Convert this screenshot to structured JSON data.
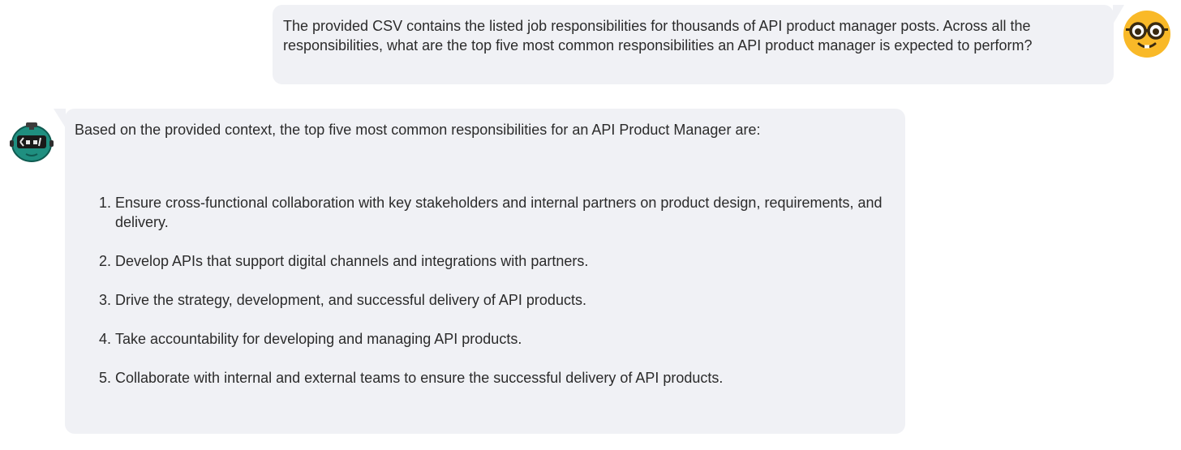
{
  "conversation": {
    "user_message": {
      "text": "The provided CSV contains the listed job responsibilities for thousands of API product manager posts. Across all the responsibilities, what are the top five most common responsibilities an API product manager is expected to perform?",
      "avatar_icon": "nerd-face-emoji-icon"
    },
    "bot_message": {
      "intro": "Based on the provided context, the top five most common responsibilities for an API Product Manager are:",
      "items": [
        "Ensure cross-functional collaboration with key stakeholders and internal partners on product design, requirements, and delivery.",
        "Develop APIs that support digital channels and integrations with partners.",
        "Drive the strategy, development, and successful delivery of API products.",
        "Take accountability for developing and managing API products.",
        "Collaborate with internal and external teams to ensure the successful delivery of API products."
      ],
      "avatar_icon": "robot-avatar-icon"
    }
  },
  "colors": {
    "bubble_background": "#f0f1f5",
    "text": "#2b2b2b",
    "user_avatar": "#f9b928",
    "bot_avatar": "#1f8f80"
  }
}
